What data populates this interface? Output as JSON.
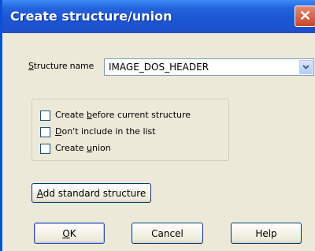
{
  "window": {
    "title": "Create structure/union",
    "close_glyph": "✕"
  },
  "structure_name": {
    "label_prefix": "S",
    "label_rest": "tructure name",
    "value": "IMAGE_DOS_HEADER",
    "arrow_icon": "chevron-down-icon"
  },
  "options": [
    {
      "pre": "Create ",
      "key": "b",
      "post": "efore current structure",
      "checked": false
    },
    {
      "pre": "",
      "key": "D",
      "post": "on't include in the list",
      "checked": false
    },
    {
      "pre": "Create ",
      "key": "u",
      "post": "nion",
      "checked": false
    }
  ],
  "buttons": {
    "add_standard": {
      "key": "A",
      "rest": "dd standard structure"
    },
    "ok": {
      "key": "O",
      "rest": "K"
    },
    "cancel": "Cancel",
    "help": "Help"
  },
  "colors": {
    "titlebar": "#1b55d4",
    "dialog_bg": "#ece9d8",
    "close_button": "#c6472b"
  }
}
